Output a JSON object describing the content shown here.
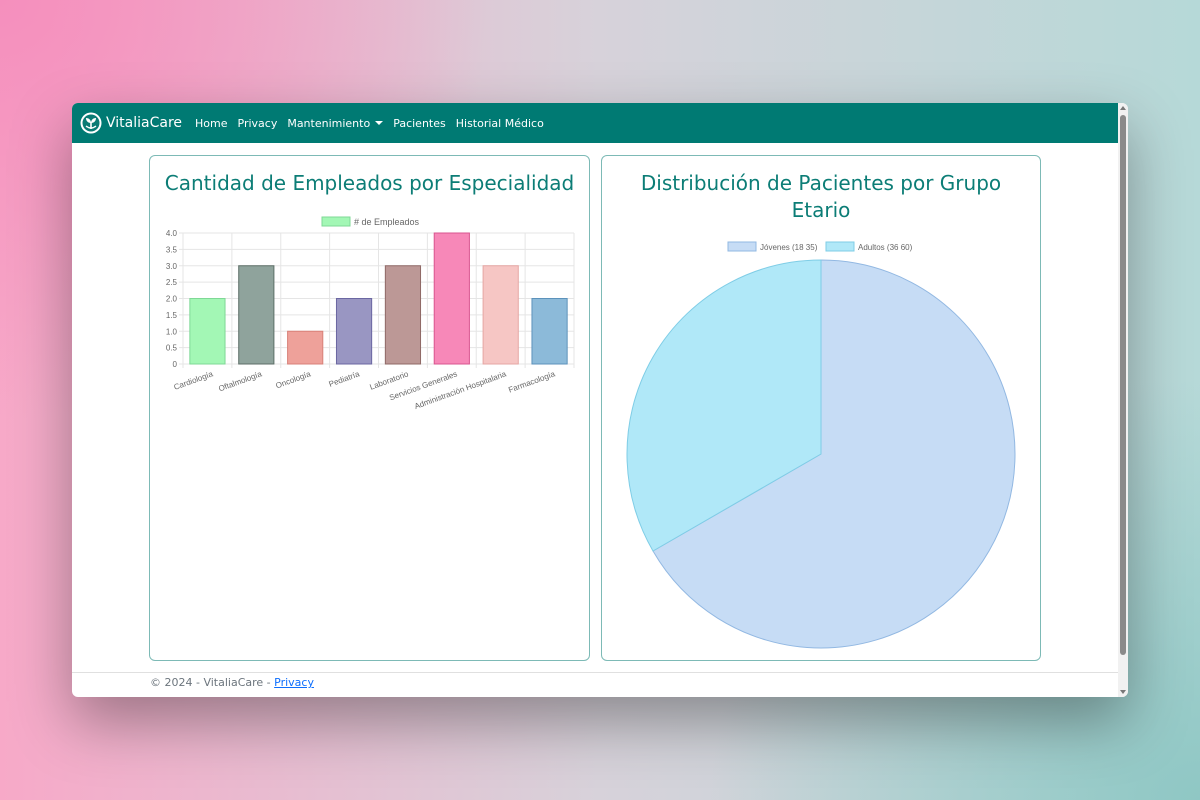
{
  "navbar": {
    "brand": "VitaliaCare",
    "items": [
      {
        "label": "Home"
      },
      {
        "label": "Privacy"
      },
      {
        "label": "Mantenimiento"
      },
      {
        "label": "Pacientes"
      },
      {
        "label": "Historial Médico"
      }
    ],
    "color": "#007a73"
  },
  "cards": {
    "left_title": "Cantidad de Empleados por Especialidad",
    "right_title": "Distribución de Pacientes por Grupo Etario"
  },
  "footer": {
    "text": "© 2024 - VitaliaCare - ",
    "link": "Privacy"
  },
  "chart_data": [
    {
      "type": "bar",
      "title": "Cantidad de Empleados por Especialidad",
      "legend": [
        "# de Empleados"
      ],
      "legend_position": "top",
      "categories": [
        "Cardiología",
        "Oftalmología",
        "Oncología",
        "Pediatría",
        "Laboratorio",
        "Servicios Generales",
        "Administración Hospitalaria",
        "Farmacología"
      ],
      "values": [
        2,
        3,
        1,
        2,
        3,
        4,
        3,
        2
      ],
      "yticks": [
        "0",
        "0.5",
        "1.0",
        "1.5",
        "2.0",
        "2.5",
        "3.0",
        "3.5",
        "4.0"
      ],
      "ylim": [
        0,
        4
      ],
      "grid": true,
      "colors": [
        "#a3f7b5",
        "#8fa39c",
        "#eea19a",
        "#9996c2",
        "#bc9896",
        "#f788b8",
        "#f6c6c4",
        "#8cbad9"
      ],
      "borders": [
        "#7fd896",
        "#5c6e67",
        "#d88078",
        "#6b67a2",
        "#8f6966",
        "#d9558f",
        "#e6a6a3",
        "#5c92bb"
      ]
    },
    {
      "type": "pie",
      "title": "Distribución de Pacientes por Grupo Etario",
      "legend": [
        "Jóvenes (18 35)",
        "Adultos (36 60)"
      ],
      "legend_position": "top",
      "values": [
        2,
        1
      ],
      "colors": [
        "#c6dcf5",
        "#b0e8f8"
      ],
      "borders": [
        "#92b8e2",
        "#7fcde6"
      ]
    }
  ]
}
